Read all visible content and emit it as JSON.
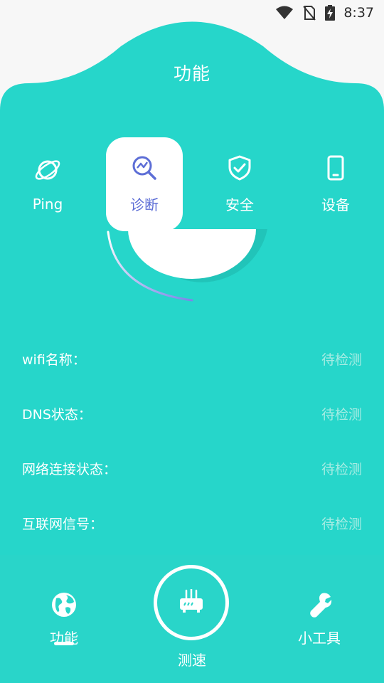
{
  "status_bar": {
    "time": "8:37",
    "icons": [
      "wifi-icon",
      "no-sim-icon",
      "battery-charging-icon"
    ]
  },
  "header": {
    "title": "功能"
  },
  "features": [
    {
      "label": "Ping",
      "icon": "planet-icon",
      "active": false
    },
    {
      "label": "诊断",
      "icon": "magnifier-chart-icon",
      "active": true
    },
    {
      "label": "安全",
      "icon": "shield-check-icon",
      "active": false
    },
    {
      "label": "设备",
      "icon": "phone-icon",
      "active": false
    }
  ],
  "info": [
    {
      "key": "wifi名称：",
      "value": "待检测"
    },
    {
      "key": "DNS状态：",
      "value": "待检测"
    },
    {
      "key": "网络连接状态：",
      "value": "待检测"
    },
    {
      "key": "互联网信号：",
      "value": "待检测"
    }
  ],
  "bottom_nav": {
    "func_label": "功能",
    "speed_label": "测速",
    "tools_label": "小工具"
  },
  "colors": {
    "primary": "#26d6ca",
    "active_text": "#5d6ed6",
    "value_text": "#a6ece3"
  }
}
